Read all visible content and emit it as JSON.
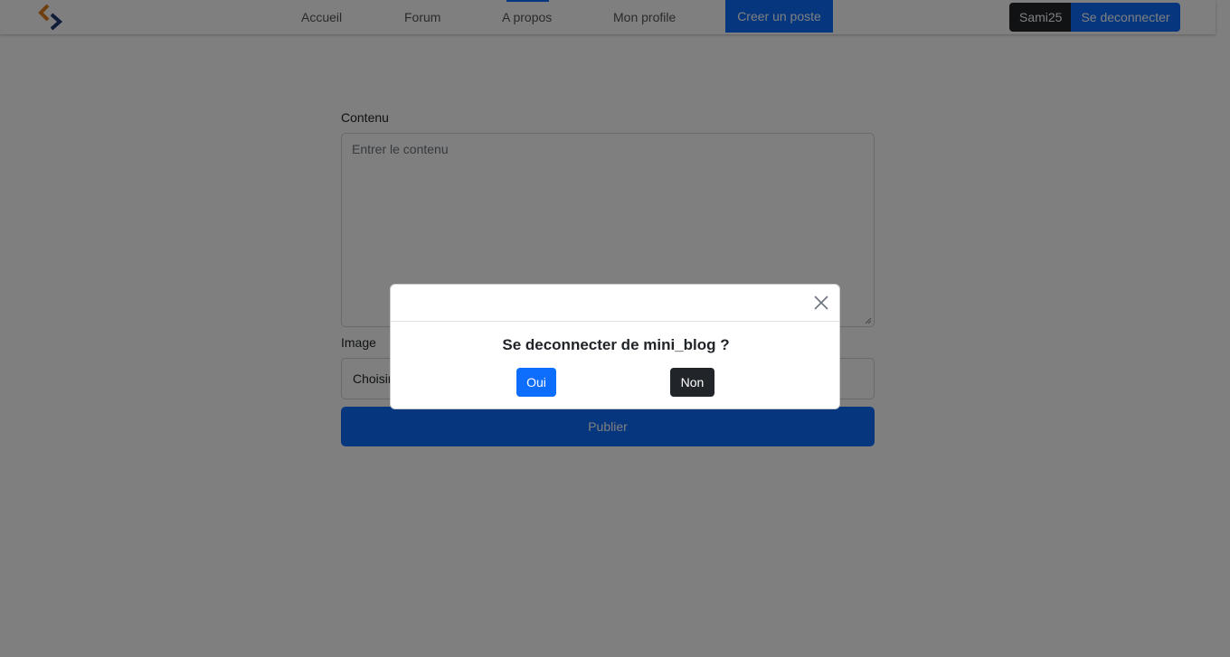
{
  "nav": {
    "logo_icon": "brand-logo-icon",
    "links": [
      "Accueil",
      "Forum",
      "A propos",
      "Mon profile"
    ],
    "create_post": "Creer un poste",
    "username": "Sami25",
    "logout": "Se deconnecter"
  },
  "form": {
    "content_label": "Contenu",
    "content_placeholder": "Entrer le contenu",
    "image_label": "Image",
    "file_button_label": "Choisir",
    "publish_label": "Publier"
  },
  "modal": {
    "close_icon": "close-icon",
    "title": "Se deconnecter de mini_blog ?",
    "yes_label": "Oui",
    "no_label": "Non"
  },
  "colors": {
    "primary": "#0d6efd",
    "dark": "#212529",
    "logo_orange": "#e07b1f",
    "logo_navy": "#1f3b73"
  }
}
